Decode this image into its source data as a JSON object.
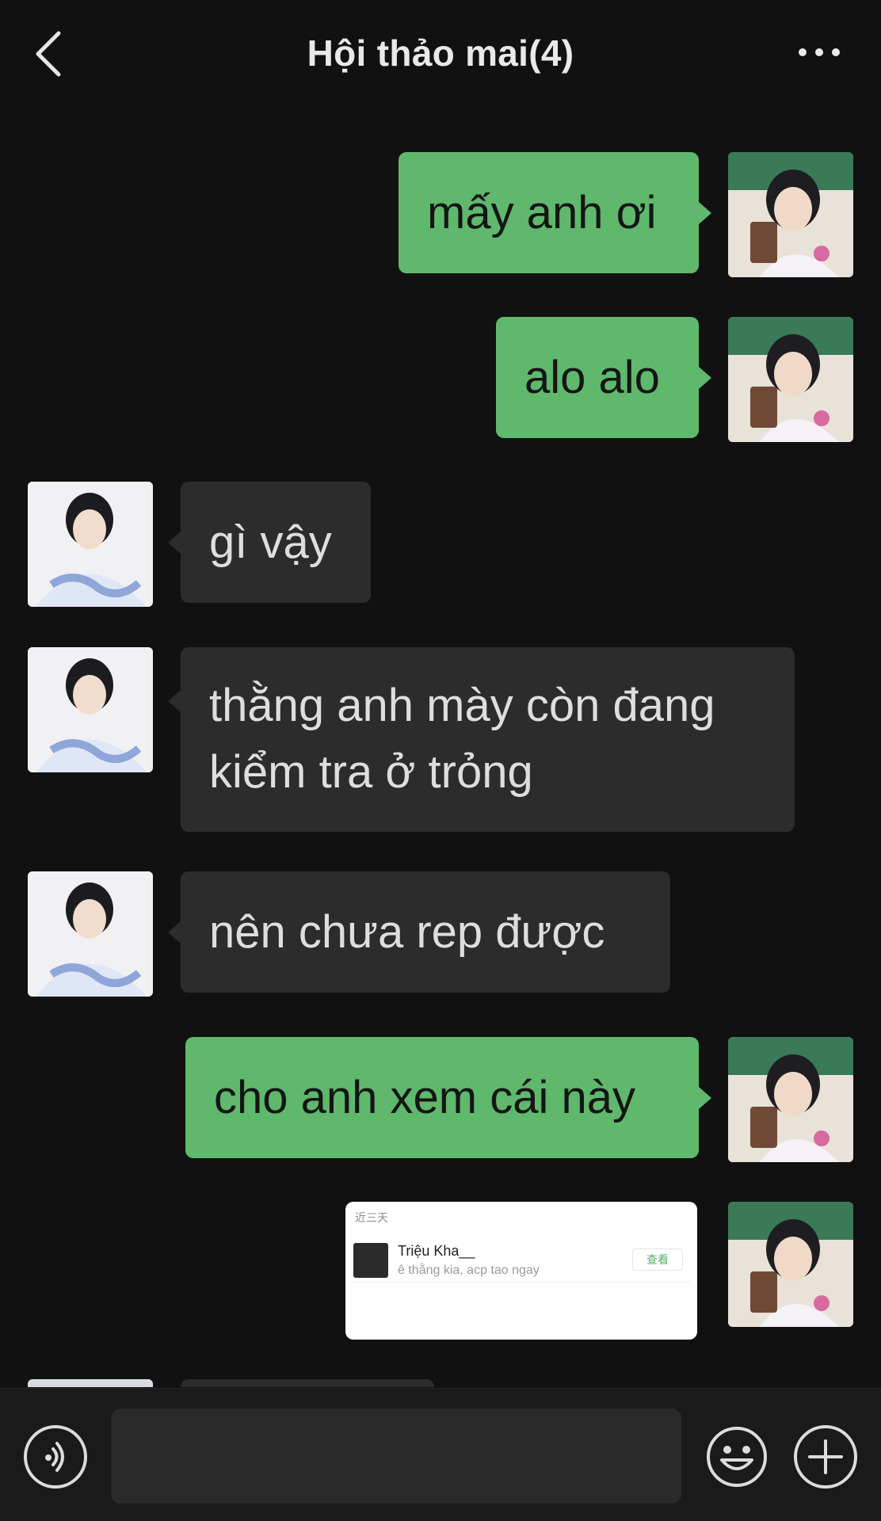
{
  "header": {
    "title": "Hội thảo mai(4)",
    "back_icon": "chevron-left-icon",
    "more_icon": "more-dots-icon"
  },
  "messages": [
    {
      "side": "right",
      "text": "mấy anh ơi"
    },
    {
      "side": "right",
      "text": "alo alo"
    },
    {
      "side": "left",
      "text": "gì vậy"
    },
    {
      "side": "left",
      "line1": "thằng anh mày còn đang",
      "line2": "kiểm tra ở trỏng"
    },
    {
      "side": "left",
      "text": "nên chưa rep được"
    },
    {
      "side": "right",
      "text": "cho anh xem cái này"
    }
  ],
  "shared_card": {
    "header": "近三天",
    "name": "Triệu Kha__",
    "message": "ê thằng  kia, acp tao ngay",
    "button": "查看"
  },
  "input_bar": {
    "placeholder": "",
    "voice_icon": "voice-icon",
    "emoji_icon": "emoji-icon",
    "plus_icon": "plus-icon"
  },
  "colors": {
    "background": "#111111",
    "sent_bubble": "#5fb86c",
    "received_bubble": "#2c2c2c",
    "header_text": "#e9e9e9"
  }
}
